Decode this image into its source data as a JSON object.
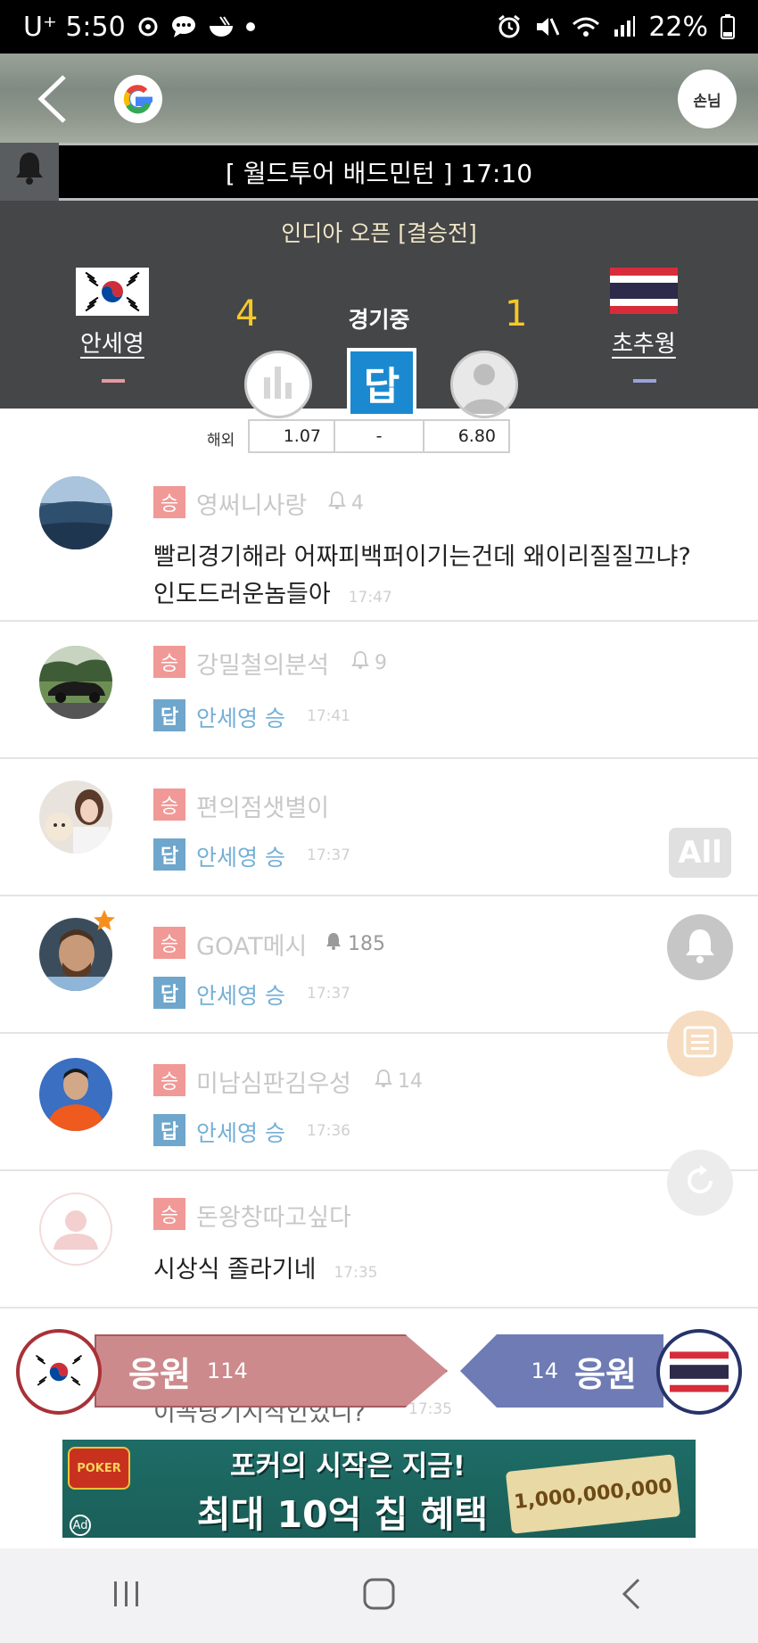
{
  "status_bar": {
    "carrier_time": "U⁺ 5:50",
    "battery": "22%",
    "icons": [
      "openai-icon",
      "chat-bubble-icon",
      "bowl-icon",
      "dot-icon",
      "alarm-icon",
      "mute-icon",
      "wifi-icon",
      "signal-icon",
      "battery-icon"
    ]
  },
  "top_nav": {
    "guest_label": "손님",
    "icons": [
      "back-chevron-icon",
      "google-icon"
    ]
  },
  "match": {
    "title": "[ 월드투어 배드민턴 ]  17:10",
    "league": "인디아 오픈 [결승전]",
    "status": "경기중",
    "answer_label": "답",
    "home": {
      "name": "안세영",
      "score": "4",
      "flag": "south-korea-flag",
      "color": "#e29aa0"
    },
    "away": {
      "name": "초추웡",
      "score": "1",
      "flag": "thailand-flag",
      "color": "#9aa3d6"
    },
    "odds": {
      "label": "해외",
      "home": "1.07",
      "draw": "-",
      "away": "6.80"
    }
  },
  "comments": [
    {
      "nick": "영써니사랑",
      "badge": "승",
      "bells": "4",
      "bell_filled": false,
      "text_line1": "빨리경기해라 어짜피백퍼이기는건데 왜이리질질끄냐?",
      "text_line2": "인도드러운놈들아",
      "time": "17:47",
      "avatar": "landscape-avatar"
    },
    {
      "nick": "강밀철의분석",
      "badge": "승",
      "bells": "9",
      "bell_filled": false,
      "answer_badge": "답",
      "answer": "안세영 승",
      "time": "17:41",
      "avatar": "car-avatar"
    },
    {
      "nick": "편의점샛별이",
      "badge": "승",
      "answer_badge": "답",
      "answer": "안세영 승",
      "time": "17:37",
      "avatar": "woman-dog-avatar"
    },
    {
      "nick": "GOAT메시",
      "badge": "승",
      "bells": "185",
      "bell_filled": true,
      "answer_badge": "답",
      "answer": "안세영 승",
      "time": "17:37",
      "avatar": "messi-avatar"
    },
    {
      "nick": "미남심판김우성",
      "badge": "승",
      "bells": "14",
      "bell_filled": false,
      "answer_badge": "답",
      "answer": "안세영 승",
      "time": "17:36",
      "avatar": "soccer-player-avatar"
    },
    {
      "nick": "돈왕창따고싶다",
      "badge": "승",
      "text_line1": "시상식 졸라기네",
      "time": "17:35",
      "avatar": "default-person-avatar"
    }
  ],
  "partial_comment": {
    "text": "이꼭당기시작인었니?",
    "time": "17:35"
  },
  "floating": {
    "all_label": "All"
  },
  "cheer": {
    "home_label": "응원",
    "home_count": "114",
    "away_label": "응원",
    "away_count": "14",
    "colors": {
      "home": "#cd8a8c",
      "away": "#6e7bb4"
    }
  },
  "ad": {
    "logo_text": "POKER",
    "tag": "Ad",
    "line1": "포커의 시작은 지금!",
    "line2": "최대 10억 칩 혜택",
    "chip_text": "1,000,000,000"
  },
  "nav_bar": {
    "icons": [
      "recent-apps-icon",
      "home-icon",
      "back-icon"
    ]
  }
}
